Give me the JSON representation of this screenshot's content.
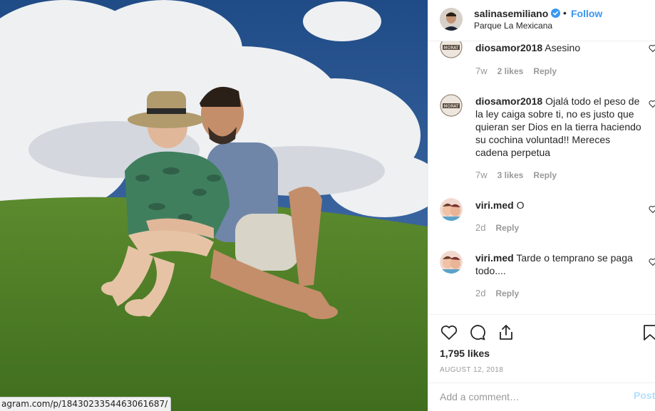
{
  "photo": {
    "status_url": "agram.com/p/1843023354463061687/"
  },
  "header": {
    "username": "salinasemiliano",
    "separator": "•",
    "follow_label": "Follow",
    "location": "Parque La Mexicana",
    "avatar_badge": ""
  },
  "comments": [
    {
      "username": "diosamor2018",
      "text": "Asesino",
      "time": "7w",
      "likes": "2 likes",
      "reply": "Reply",
      "avatar_badge": "MORAT"
    },
    {
      "username": "diosamor2018",
      "text": "Ojalá todo el peso de la ley caiga sobre ti, no es justo que quieran ser Dios en la tierra haciendo su cochina voluntad!! Mereces cadena perpetua",
      "time": "7w",
      "likes": "3 likes",
      "reply": "Reply",
      "avatar_badge": "MORAT"
    },
    {
      "username": "viri.med",
      "text": "O",
      "time": "2d",
      "likes": "",
      "reply": "Reply",
      "avatar_badge": ""
    },
    {
      "username": "viri.med",
      "text": "Tarde o temprano se paga todo....",
      "time": "2d",
      "likes": "",
      "reply": "Reply",
      "avatar_badge": ""
    }
  ],
  "actions": {
    "likes_count": "1,795 likes",
    "date": "AUGUST 12, 2018"
  },
  "add_comment": {
    "placeholder": "Add a comment…",
    "post_label": "Post"
  },
  "icons": {
    "verified": "verified-badge-icon",
    "like": "heart-icon",
    "comment": "comment-icon",
    "share": "share-icon",
    "save": "bookmark-icon"
  },
  "colors": {
    "link_blue": "#3897f0",
    "muted": "#999999",
    "border": "#efefef",
    "post_disabled": "#b2dffc"
  }
}
